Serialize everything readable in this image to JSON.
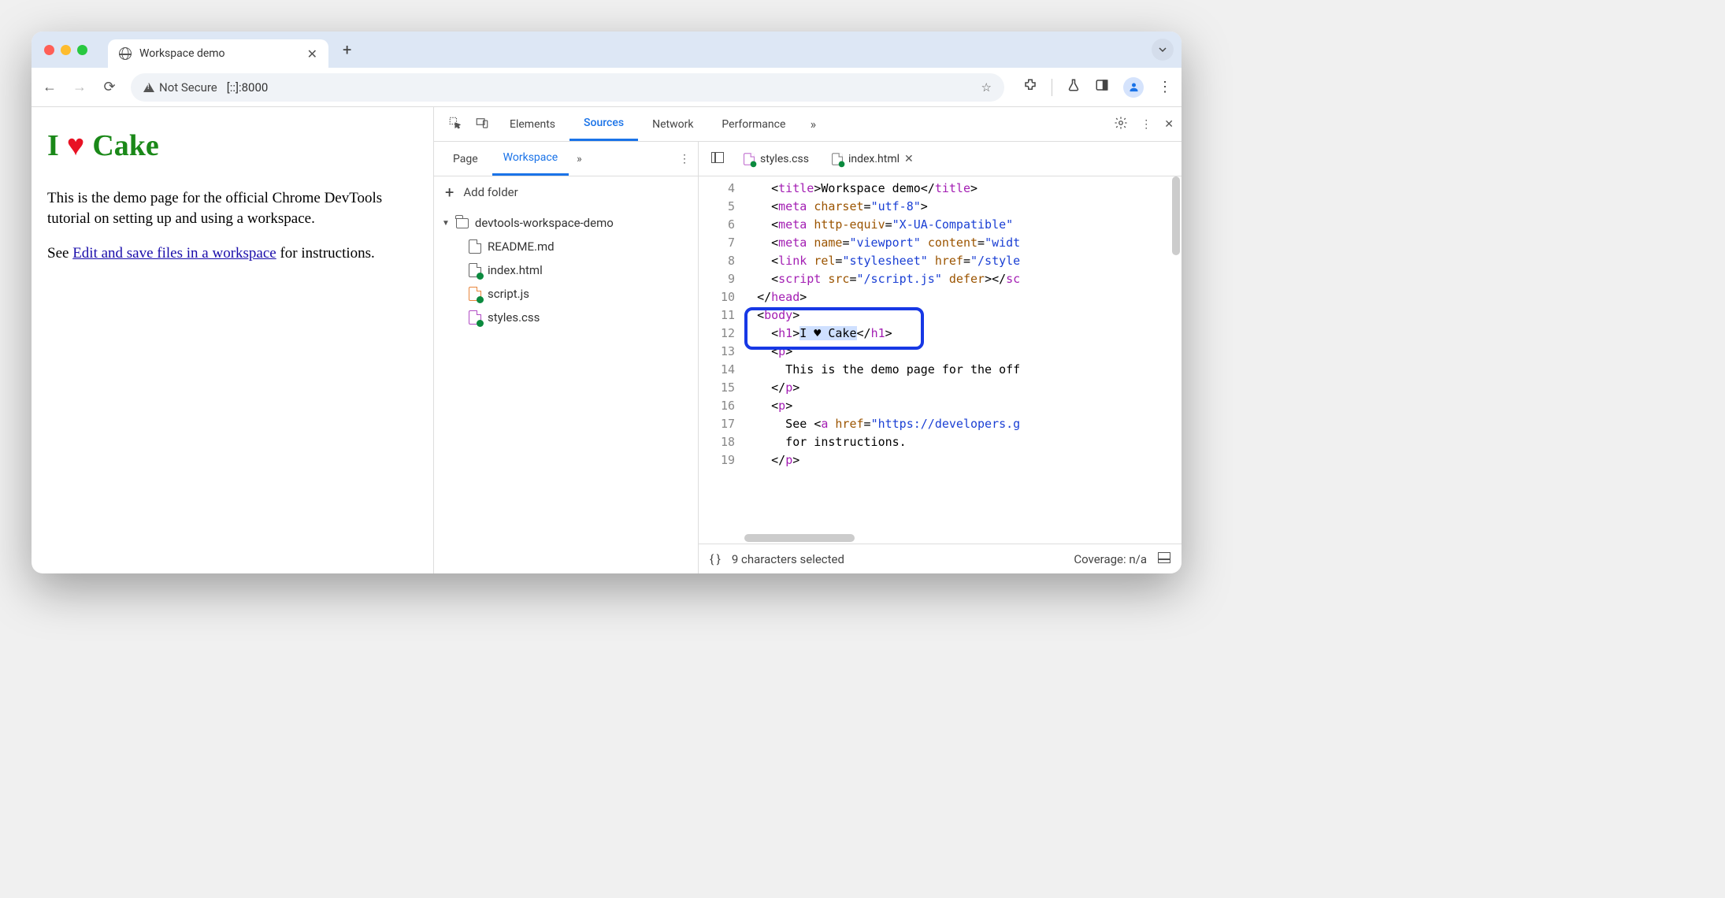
{
  "browser": {
    "tab_title": "Workspace demo",
    "security_label": "Not Secure",
    "address": "[::]:8000"
  },
  "page": {
    "h1_prefix": "I",
    "h1_suffix": "Cake",
    "para1": "This is the demo page for the official Chrome DevTools tutorial on setting up and using a workspace.",
    "para2_pre": "See ",
    "para2_link": "Edit and save files in a workspace",
    "para2_post": " for instructions."
  },
  "devtools": {
    "tabs": [
      "Elements",
      "Sources",
      "Network",
      "Performance"
    ],
    "active_tab": "Sources",
    "sources": {
      "subtabs": [
        "Page",
        "Workspace"
      ],
      "active_subtab": "Workspace",
      "add_folder_label": "Add folder",
      "root_folder": "devtools-workspace-demo",
      "files": [
        "README.md",
        "index.html",
        "script.js",
        "styles.css"
      ]
    },
    "editor": {
      "open_tabs": [
        "styles.css",
        "index.html"
      ],
      "active_tab": "index.html",
      "first_line_number": 4,
      "lines": [
        {
          "n": 4,
          "html": "    <span class='punct'>&lt;</span><span class='tag'>title</span><span class='punct'>&gt;</span>Workspace demo<span class='punct'>&lt;/</span><span class='tag'>title</span><span class='punct'>&gt;</span>"
        },
        {
          "n": 5,
          "html": "    <span class='punct'>&lt;</span><span class='tag'>meta</span> <span class='attr'>charset</span>=<span class='str'>\"utf-8\"</span><span class='punct'>&gt;</span>"
        },
        {
          "n": 6,
          "html": "    <span class='punct'>&lt;</span><span class='tag'>meta</span> <span class='attr'>http-equiv</span>=<span class='str'>\"X-UA-Compatible\"</span>"
        },
        {
          "n": 7,
          "html": "    <span class='punct'>&lt;</span><span class='tag'>meta</span> <span class='attr'>name</span>=<span class='str'>\"viewport\"</span> <span class='attr'>content</span>=<span class='str'>\"widt</span>"
        },
        {
          "n": 8,
          "html": "    <span class='punct'>&lt;</span><span class='tag'>link</span> <span class='attr'>rel</span>=<span class='str'>\"stylesheet\"</span> <span class='attr'>href</span>=<span class='str'>\"/style</span>"
        },
        {
          "n": 9,
          "html": "    <span class='punct'>&lt;</span><span class='tag'>script</span> <span class='attr'>src</span>=<span class='str'>\"/script.js\"</span> <span class='attr'>defer</span><span class='punct'>&gt;&lt;/</span><span class='tag'>sc</span>"
        },
        {
          "n": 10,
          "html": "  <span class='punct'>&lt;/</span><span class='tag'>head</span><span class='punct'>&gt;</span>"
        },
        {
          "n": 11,
          "html": "  <span class='punct'>&lt;</span><span class='tag'>body</span><span class='punct'>&gt;</span>"
        },
        {
          "n": 12,
          "html": "    <span class='punct'>&lt;</span><span class='tag'>h1</span><span class='punct'>&gt;</span><span style='background:#cfe0ff'>I ♥ Cake</span><span class='punct'>&lt;/</span><span class='tag'>h1</span><span class='punct'>&gt;</span>"
        },
        {
          "n": 13,
          "html": "    <span class='punct'>&lt;</span><span class='tag'>p</span><span class='punct'>&gt;</span>"
        },
        {
          "n": 14,
          "html": "      This is the demo page for the off"
        },
        {
          "n": 15,
          "html": "    <span class='punct'>&lt;/</span><span class='tag'>p</span><span class='punct'>&gt;</span>"
        },
        {
          "n": 16,
          "html": "    <span class='punct'>&lt;</span><span class='tag'>p</span><span class='punct'>&gt;</span>"
        },
        {
          "n": 17,
          "html": "      See <span class='punct'>&lt;</span><span class='tag'>a</span> <span class='attr'>href</span>=<span class='str'>\"https://developers.g</span>"
        },
        {
          "n": 18,
          "html": "      for instructions."
        },
        {
          "n": 19,
          "html": "    <span class='punct'>&lt;/</span><span class='tag'>p</span><span class='punct'>&gt;</span>"
        }
      ]
    },
    "status": {
      "selection": "9 characters selected",
      "coverage": "Coverage: n/a"
    }
  }
}
